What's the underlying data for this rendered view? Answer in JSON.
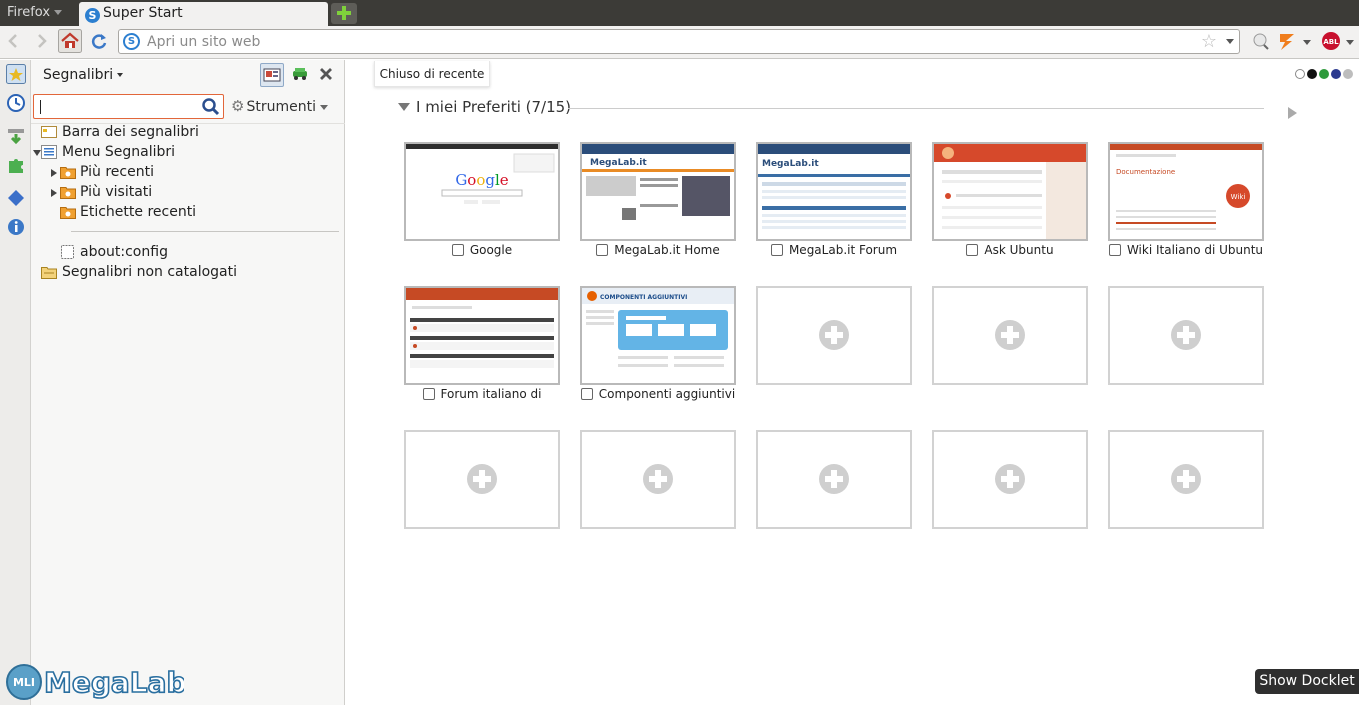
{
  "window": {
    "firefox_menu": "Firefox",
    "tab_title": "Super Start",
    "tab_favicon": "S"
  },
  "navbar": {
    "url_placeholder": "Apri un sito web",
    "site_icon": "S"
  },
  "sidebar": {
    "title": "Segnalibri",
    "search_value": "",
    "tools_label": "Strumenti",
    "items": [
      {
        "label": "Barra dei segnalibri",
        "icon": "toolbar-folder-icon"
      },
      {
        "label": "Menu Segnalibri",
        "icon": "menu-folder-icon",
        "expanded": true
      },
      {
        "label": "Più recenti",
        "icon": "smart-folder-icon"
      },
      {
        "label": "Più visitati",
        "icon": "smart-folder-icon"
      },
      {
        "label": "Etichette recenti",
        "icon": "smart-folder-icon"
      },
      {
        "label": "about:config",
        "icon": "blank-page-icon"
      },
      {
        "label": "Segnalibri non catalogati",
        "icon": "unsorted-folder-icon"
      }
    ]
  },
  "logo": {
    "text": "MegaLab.it",
    "badge": "MLI"
  },
  "main": {
    "recent_closed": "Chiuso di recente",
    "theme_dots": [
      "#ffffff",
      "#111111",
      "#2e9a3c",
      "#2b3a8f",
      "#bdbdbd"
    ],
    "group_title": "I miei Preferiti (7/15)",
    "tiles": [
      {
        "caption": "Google",
        "thumb": "google"
      },
      {
        "caption": "MegaLab.it Home",
        "thumb": "megalab-home"
      },
      {
        "caption": "MegaLab.it Forum",
        "thumb": "megalab-forum"
      },
      {
        "caption": "Ask Ubuntu",
        "thumb": "askubuntu"
      },
      {
        "caption": "Wiki Italiano di Ubuntu",
        "thumb": "wiki"
      },
      {
        "caption": "Forum italiano di",
        "thumb": "forum-ubuntu"
      },
      {
        "caption": "Componenti aggiuntivi",
        "thumb": "addons"
      }
    ],
    "empty_tiles": 8
  },
  "docklet_label": "Show Docklet"
}
